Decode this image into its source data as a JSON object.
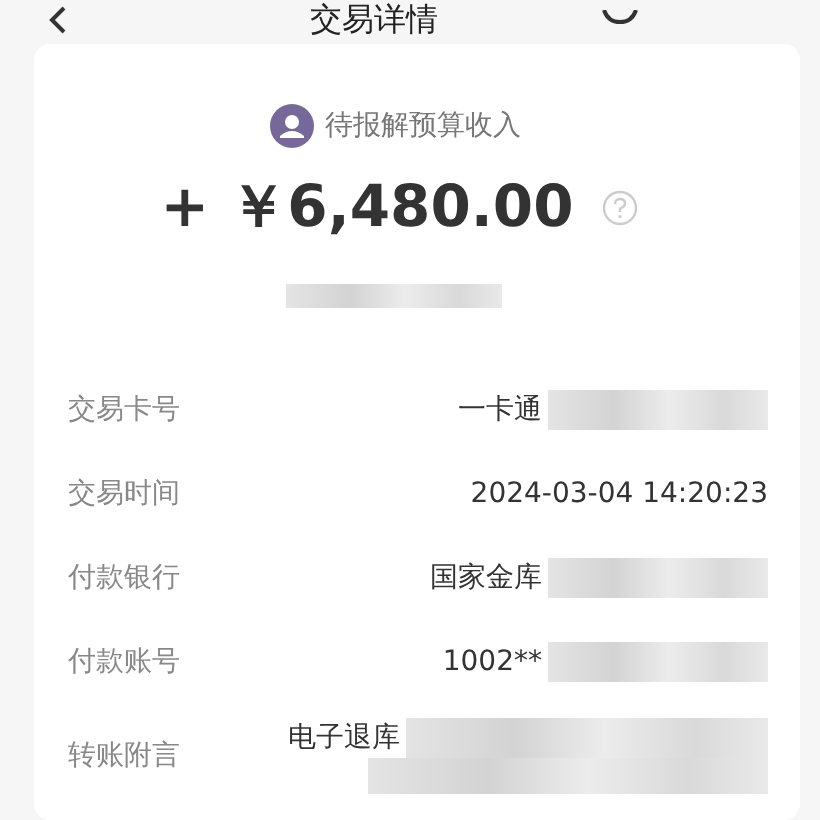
{
  "header": {
    "title": "交易详情"
  },
  "summary": {
    "category": "待报解预算收入",
    "amount": "+ ￥6,480.00"
  },
  "details": [
    {
      "label": "交易卡号",
      "value": "一卡通",
      "kind": "line"
    },
    {
      "label": "交易时间",
      "value": "2024-03-04 14:20:23",
      "kind": "plain"
    },
    {
      "label": "付款银行",
      "value": "国家金库",
      "kind": "line"
    },
    {
      "label": "付款账号",
      "value": "1002**",
      "kind": "line"
    },
    {
      "label": "转账附言",
      "value": "电子退库",
      "kind": "block"
    }
  ]
}
